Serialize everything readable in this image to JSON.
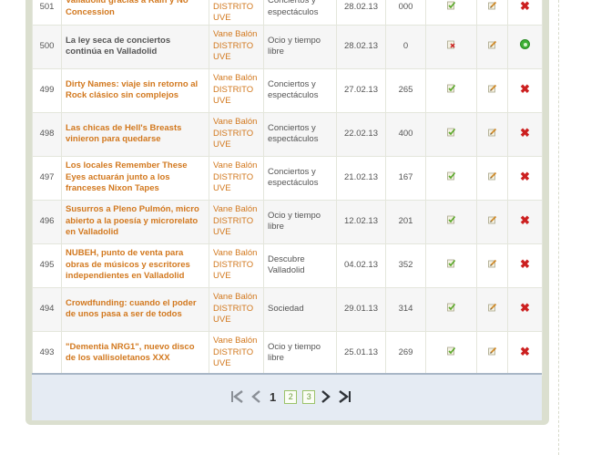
{
  "rows": [
    {
      "id": "501",
      "title": "Valladolid gracias a Rain y No Concession",
      "author": "Vane Balón DISTRITO UVE",
      "category": "Conciertos y espectáculos",
      "date": "28.02.13",
      "views": "000",
      "published": true,
      "first": true
    },
    {
      "id": "500",
      "title": "La ley seca de conciertos continúa en Valladolid",
      "author": "Vane Balón DISTRITO UVE",
      "category": "Ocio y tiempo libre",
      "date": "28.02.13",
      "views": "0",
      "published": false,
      "gray": true
    },
    {
      "id": "499",
      "title": "Dirty Names: viaje sin retorno al Rock clásico sin complejos",
      "author": "Vane Balón DISTRITO UVE",
      "category": "Conciertos y espectáculos",
      "date": "27.02.13",
      "views": "265",
      "published": true
    },
    {
      "id": "498",
      "title": "Las chicas de Hell's Breasts vinieron para quedarse",
      "author": "Vane Balón DISTRITO UVE",
      "category": "Conciertos y espectáculos",
      "date": "22.02.13",
      "views": "400",
      "published": true
    },
    {
      "id": "497",
      "title": "Los locales Remember These Eyes actuarán junto a los franceses Nixon Tapes",
      "author": "Vane Balón DISTRITO UVE",
      "category": "Conciertos y espectáculos",
      "date": "21.02.13",
      "views": "167",
      "published": true
    },
    {
      "id": "496",
      "title": "Susurros a Pleno Pulmón, micro abierto a la poesía y microrelato en Valladolid",
      "author": "Vane Balón DISTRITO UVE",
      "category": "Ocio y tiempo libre",
      "date": "12.02.13",
      "views": "201",
      "published": true
    },
    {
      "id": "495",
      "title": "NUBEH, punto de venta para obras de músicos y escritores independientes en Valladolid",
      "author": "Vane Balón DISTRITO UVE",
      "category": "Descubre Valladolid",
      "date": "04.02.13",
      "views": "352",
      "published": true
    },
    {
      "id": "494",
      "title": "Crowdfunding: cuando el poder de unos pasa a ser de todos",
      "author": "Vane Balón DISTRITO UVE",
      "category": "Sociedad",
      "date": "29.01.13",
      "views": "314",
      "published": true
    },
    {
      "id": "493",
      "title": "\"Dementia NRG1\", nuevo disco de los vallisoletanos XXX",
      "author": "Vane Balón DISTRITO UVE",
      "category": "Ocio y tiempo libre",
      "date": "25.01.13",
      "views": "269",
      "published": true
    }
  ],
  "pagination": {
    "current": "1",
    "pages": [
      "2",
      "3"
    ],
    "icons": [
      "first-page-icon",
      "prev-page-icon",
      "next-page-icon",
      "last-page-icon"
    ]
  },
  "colors": {
    "link": "#d2781e",
    "delete": "#cc2020",
    "ok": "#3db035",
    "panel": "#dbdfcf",
    "pager_bg": "#e5ebf3"
  }
}
